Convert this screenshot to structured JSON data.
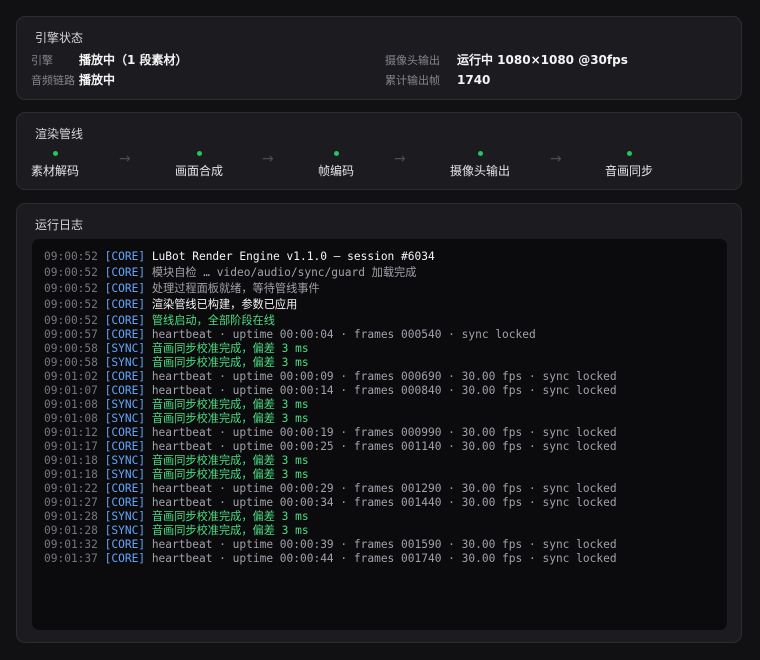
{
  "engine_status": {
    "title": "引擎状态",
    "rows": [
      {
        "label": "引擎",
        "value": "播放中（1 段素材）"
      },
      {
        "label": "音频链路",
        "value": "播放中"
      }
    ],
    "rows_right": [
      {
        "label": "摄像头输出",
        "value": "运行中 1080×1080 @30fps"
      },
      {
        "label": "累计输出帧",
        "value": "1740"
      }
    ]
  },
  "pipeline": {
    "title": "渲染管线",
    "status_color": "#22c55e",
    "arrow_glyph": "→",
    "stages": [
      {
        "label": "素材解码"
      },
      {
        "label": "画面合成"
      },
      {
        "label": "帧编码"
      },
      {
        "label": "摄像头输出"
      },
      {
        "label": "音画同步"
      }
    ]
  },
  "log": {
    "title": "运行日志",
    "colors": {
      "tag": "#60a5fa",
      "white": "#f4f4f5",
      "gray": "#a1a1aa",
      "green": "#4ade80"
    },
    "lines": [
      {
        "time": "09:00:52",
        "tag": "[CORE]",
        "msg": "LuBot Render Engine v1.1.0 — session #6034",
        "tone": "white"
      },
      {
        "time": "09:00:52",
        "tag": "[CORE]",
        "msg": "模块自检 … video/audio/sync/guard 加载完成",
        "tone": "gray"
      },
      {
        "time": "09:00:52",
        "tag": "[CORE]",
        "msg": "处理过程面板就绪，等待管线事件",
        "tone": "gray"
      },
      {
        "time": "09:00:52",
        "tag": "[CORE]",
        "msg": "渲染管线已构建，参数已应用",
        "tone": "white"
      },
      {
        "time": "09:00:52",
        "tag": "[CORE]",
        "msg": "管线启动，全部阶段在线",
        "tone": "green"
      },
      {
        "time": "09:00:57",
        "tag": "[CORE]",
        "msg": "heartbeat · uptime 00:00:04 · frames 000540 · sync locked",
        "tone": "gray"
      },
      {
        "time": "09:00:58",
        "tag": "[SYNC]",
        "msg": "音画同步校准完成，偏差 3 ms",
        "tone": "green"
      },
      {
        "time": "09:00:58",
        "tag": "[SYNC]",
        "msg": "音画同步校准完成，偏差 3 ms",
        "tone": "green"
      },
      {
        "time": "09:01:02",
        "tag": "[CORE]",
        "msg": "heartbeat · uptime 00:00:09 · frames 000690 · 30.00 fps · sync locked",
        "tone": "gray"
      },
      {
        "time": "09:01:07",
        "tag": "[CORE]",
        "msg": "heartbeat · uptime 00:00:14 · frames 000840 · 30.00 fps · sync locked",
        "tone": "gray"
      },
      {
        "time": "09:01:08",
        "tag": "[SYNC]",
        "msg": "音画同步校准完成，偏差 3 ms",
        "tone": "green"
      },
      {
        "time": "09:01:08",
        "tag": "[SYNC]",
        "msg": "音画同步校准完成，偏差 3 ms",
        "tone": "green"
      },
      {
        "time": "09:01:12",
        "tag": "[CORE]",
        "msg": "heartbeat · uptime 00:00:19 · frames 000990 · 30.00 fps · sync locked",
        "tone": "gray"
      },
      {
        "time": "09:01:17",
        "tag": "[CORE]",
        "msg": "heartbeat · uptime 00:00:25 · frames 001140 · 30.00 fps · sync locked",
        "tone": "gray"
      },
      {
        "time": "09:01:18",
        "tag": "[SYNC]",
        "msg": "音画同步校准完成，偏差 3 ms",
        "tone": "green"
      },
      {
        "time": "09:01:18",
        "tag": "[SYNC]",
        "msg": "音画同步校准完成，偏差 3 ms",
        "tone": "green"
      },
      {
        "time": "09:01:22",
        "tag": "[CORE]",
        "msg": "heartbeat · uptime 00:00:29 · frames 001290 · 30.00 fps · sync locked",
        "tone": "gray"
      },
      {
        "time": "09:01:27",
        "tag": "[CORE]",
        "msg": "heartbeat · uptime 00:00:34 · frames 001440 · 30.00 fps · sync locked",
        "tone": "gray"
      },
      {
        "time": "09:01:28",
        "tag": "[SYNC]",
        "msg": "音画同步校准完成，偏差 3 ms",
        "tone": "green"
      },
      {
        "time": "09:01:28",
        "tag": "[SYNC]",
        "msg": "音画同步校准完成，偏差 3 ms",
        "tone": "green"
      },
      {
        "time": "09:01:32",
        "tag": "[CORE]",
        "msg": "heartbeat · uptime 00:00:39 · frames 001590 · 30.00 fps · sync locked",
        "tone": "gray"
      },
      {
        "time": "09:01:37",
        "tag": "[CORE]",
        "msg": "heartbeat · uptime 00:00:44 · frames 001740 · 30.00 fps · sync locked",
        "tone": "gray"
      }
    ]
  }
}
